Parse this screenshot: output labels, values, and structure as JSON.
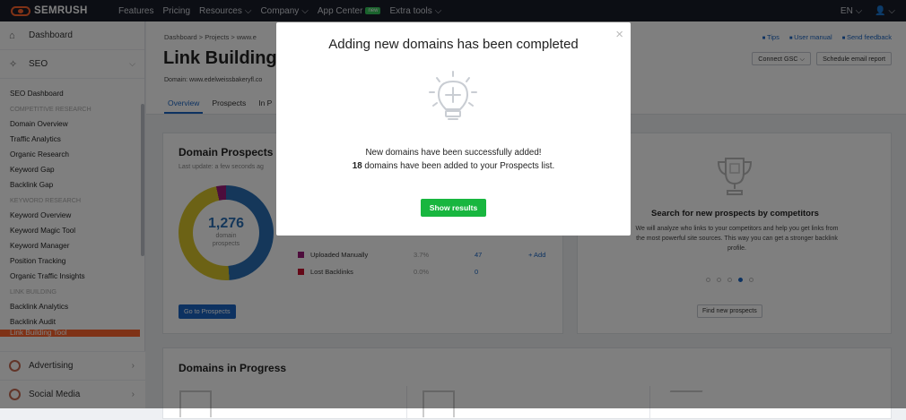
{
  "topbar": {
    "brand": "SEMRUSH",
    "nav": [
      "Features",
      "Pricing",
      "Resources",
      "Company",
      "App Center",
      "Extra tools"
    ],
    "new_badge": "new",
    "lang": "EN"
  },
  "sidebar": {
    "dashboard": "Dashboard",
    "seo": "SEO",
    "items": [
      {
        "type": "item",
        "label": "SEO Dashboard"
      },
      {
        "type": "cat",
        "label": "COMPETITIVE RESEARCH"
      },
      {
        "type": "item",
        "label": "Domain Overview"
      },
      {
        "type": "item",
        "label": "Traffic Analytics"
      },
      {
        "type": "item",
        "label": "Organic Research"
      },
      {
        "type": "item",
        "label": "Keyword Gap"
      },
      {
        "type": "item",
        "label": "Backlink Gap"
      },
      {
        "type": "cat",
        "label": "KEYWORD RESEARCH"
      },
      {
        "type": "item",
        "label": "Keyword Overview"
      },
      {
        "type": "item",
        "label": "Keyword Magic Tool"
      },
      {
        "type": "item",
        "label": "Keyword Manager"
      },
      {
        "type": "item",
        "label": "Position Tracking"
      },
      {
        "type": "item",
        "label": "Organic Traffic Insights"
      },
      {
        "type": "cat",
        "label": "LINK BUILDING"
      },
      {
        "type": "item",
        "label": "Backlink Analytics"
      },
      {
        "type": "item",
        "label": "Backlink Audit"
      }
    ],
    "active_item": "Link Building Tool",
    "advertising": "Advertising",
    "social_media": "Social Media"
  },
  "header": {
    "breadcrumb": "Dashboard  >  Projects  >  www.e",
    "title": "Link Building",
    "domain": "Domain: www.edelweissbakeryfl.co",
    "tabs": [
      "Overview",
      "Prospects",
      "In P"
    ],
    "links": [
      "Tips",
      "User manual",
      "Send feedback"
    ],
    "connect_gsc": "Connect GSC",
    "schedule_email": "Schedule email report"
  },
  "prospects_card": {
    "title": "Domain Prospects",
    "subtitle": "Last update: a few seconds ag",
    "total": "1,276",
    "total_label_1": "domain",
    "total_label_2": "prospects",
    "legend": [
      {
        "name": "Uploaded Manually",
        "pct": "3.7%",
        "count": "47",
        "add": "+ Add",
        "color": "#9b1b78"
      },
      {
        "name": "Lost Backlinks",
        "pct": "0.0%",
        "count": "0",
        "add": "",
        "color": "#c8102e"
      }
    ],
    "goto_button": "Go to Prospects"
  },
  "search_card": {
    "title": "Search for new prospects by competitors",
    "text": "We will analyze who links to your competitors and help you get links from the most powerful site sources. This way you can get a stronger backlink profile.",
    "active_dot": 3,
    "find_button": "Find new prospects"
  },
  "progress_card": {
    "title": "Domains in Progress"
  },
  "modal": {
    "title": "Adding new domains has been completed",
    "line1": "New domains have been successfully added!",
    "count": "18",
    "line2_rest": " domains have been added to your Prospects list.",
    "button": "Show results",
    "close": "×"
  },
  "colors": {
    "accent": "#ff642d",
    "primary_blue": "#1a65c3",
    "success_green": "#18b63f"
  }
}
